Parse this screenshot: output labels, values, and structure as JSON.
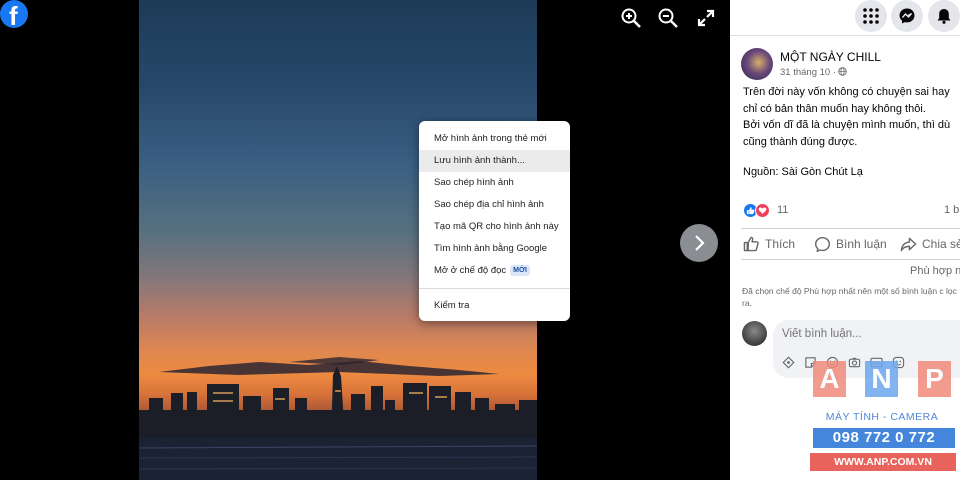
{
  "viewer": {
    "logo_icon": "facebook-logo",
    "tools": [
      {
        "name": "zoom-in-icon"
      },
      {
        "name": "zoom-out-icon"
      },
      {
        "name": "fullscreen-icon"
      }
    ],
    "next_icon": "chevron-right-icon"
  },
  "context_menu": {
    "items": [
      "Mở hình ảnh trong thẻ mới",
      "Lưu hình ảnh thành...",
      "Sao chép hình ảnh",
      "Sao chép địa chỉ hình ảnh",
      "Tạo mã QR cho hình ảnh này",
      "Tìm hình ảnh bằng Google",
      "Mở ở chế độ đọc"
    ],
    "new_badge": "MỚI",
    "inspect": "Kiểm tra"
  },
  "header_icons": [
    "menu-grid-icon",
    "messenger-icon",
    "bell-icon"
  ],
  "post": {
    "page_name": "MỘT NGÀY CHILL",
    "date": "31 tháng 10 ·",
    "text_lines": [
      "Trên đời này vốn không có chuyện sai hay",
      "chỉ có bản thân muốn hay không thôi.",
      "Bởi vốn dĩ đã là chuyện mình muốn, thì dù",
      "cũng thành đúng được."
    ],
    "source": "Nguồn: Sài Gòn Chút Lạ",
    "reaction_count": "11",
    "comment_count": "1 b",
    "actions": {
      "like": "Thích",
      "comment": "Bình luận",
      "share": "Chia sẻ"
    },
    "sort_label": "Phù hợp n",
    "filter_note": "Đã chọn chế độ Phù hợp nhất nên một số bình luận c lọc ra.",
    "comment_placeholder": "Viết bình luận..."
  },
  "watermark": {
    "letters": [
      "A",
      "N",
      "P"
    ],
    "letter_colors": [
      "#f08a7c",
      "#6ea7f0",
      "#f08a7c"
    ],
    "tagline": "MÁY TÍNH - CAMERA",
    "phone": "098 772 0 772",
    "website": "WWW.ANP.COM.VN"
  }
}
